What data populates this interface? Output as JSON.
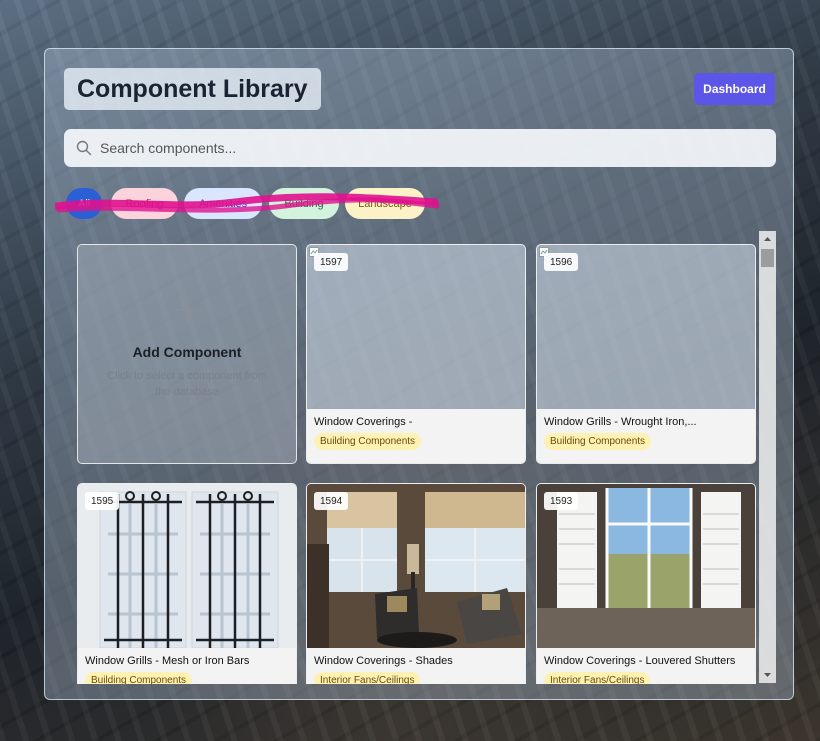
{
  "page": {
    "title": "Component Library"
  },
  "header": {
    "dashboard_label": "Dashboard"
  },
  "search": {
    "placeholder": "Search components..."
  },
  "filters": [
    {
      "label": "All",
      "bg": "#2a5fd6",
      "fg": "#ffffff",
      "active": true
    },
    {
      "label": "Roofing",
      "bg": "#fbd3dc",
      "fg": "#8a2440"
    },
    {
      "label": "Amenities",
      "bg": "#d9e6fd",
      "fg": "#2448a0"
    },
    {
      "label": "Building",
      "bg": "#d4f3dd",
      "fg": "#226b3a"
    },
    {
      "label": "Landscape",
      "bg": "#fbf2c7",
      "fg": "#7a5b10"
    }
  ],
  "add_card": {
    "title": "Add Component",
    "subtitle": "Click to select a component from the database"
  },
  "cards": [
    {
      "id": "1597",
      "title": "Window Coverings -",
      "category": "Building Components",
      "image": "broken"
    },
    {
      "id": "1596",
      "title": "Window Grills - Wrought Iron,...",
      "category": "Building Components",
      "image": "broken"
    },
    {
      "id": "1595",
      "title": "Window Grills - Mesh or Iron Bars",
      "category": "Building Components",
      "image": "window-grills-photo"
    },
    {
      "id": "1594",
      "title": "Window Coverings - Shades",
      "category": "Interior Fans/Ceilings",
      "image": "living-room-shades-photo"
    },
    {
      "id": "1593",
      "title": "Window Coverings - Louvered Shutters",
      "category": "Interior Fans/Ceilings",
      "image": "shutters-window-photo"
    }
  ],
  "colors": {
    "accent": "#5b55e8",
    "category_badge": "#fdf2b3",
    "scribble": "#e0118f"
  }
}
